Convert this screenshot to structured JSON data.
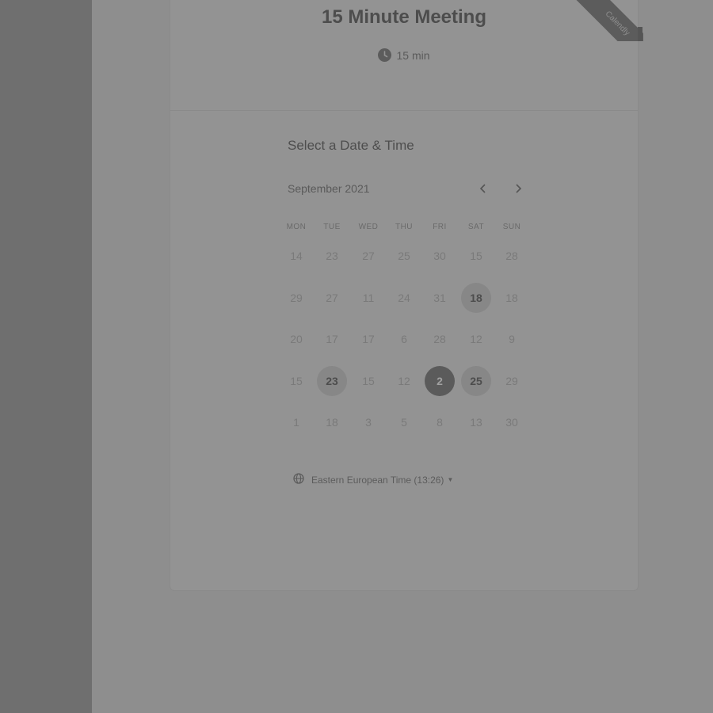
{
  "event": {
    "title": "15 Minute Meeting",
    "duration": "15 min"
  },
  "ribbon": {
    "text": "Calendly"
  },
  "calendar": {
    "heading": "Select a Date & Time",
    "month": "September 2021",
    "weekdays": [
      "MON",
      "TUE",
      "WED",
      "THU",
      "FRI",
      "SAT",
      "SUN"
    ],
    "weeks": [
      [
        {
          "label": "14"
        },
        {
          "label": "23"
        },
        {
          "label": "27"
        },
        {
          "label": "25"
        },
        {
          "label": "30"
        },
        {
          "label": "15"
        },
        {
          "label": "28"
        }
      ],
      [
        {
          "label": "29"
        },
        {
          "label": "27"
        },
        {
          "label": "11"
        },
        {
          "label": "24"
        },
        {
          "label": "31"
        },
        {
          "label": "18",
          "state": "available"
        },
        {
          "label": "18"
        }
      ],
      [
        {
          "label": "20"
        },
        {
          "label": "17"
        },
        {
          "label": "17"
        },
        {
          "label": "6"
        },
        {
          "label": "28"
        },
        {
          "label": "12"
        },
        {
          "label": "9"
        }
      ],
      [
        {
          "label": "15"
        },
        {
          "label": "23",
          "state": "available"
        },
        {
          "label": "15"
        },
        {
          "label": "12"
        },
        {
          "label": "2",
          "state": "selected"
        },
        {
          "label": "25",
          "state": "available"
        },
        {
          "label": "29"
        }
      ],
      [
        {
          "label": "1"
        },
        {
          "label": "18"
        },
        {
          "label": "3"
        },
        {
          "label": "5"
        },
        {
          "label": "8"
        },
        {
          "label": "13"
        },
        {
          "label": "30"
        }
      ]
    ]
  },
  "timezone": {
    "label": "Eastern European Time (13:26)"
  },
  "colors": {
    "overlay": "#8e8e8e",
    "selected_day": "#5b5b5b",
    "available_day": "#878787"
  }
}
